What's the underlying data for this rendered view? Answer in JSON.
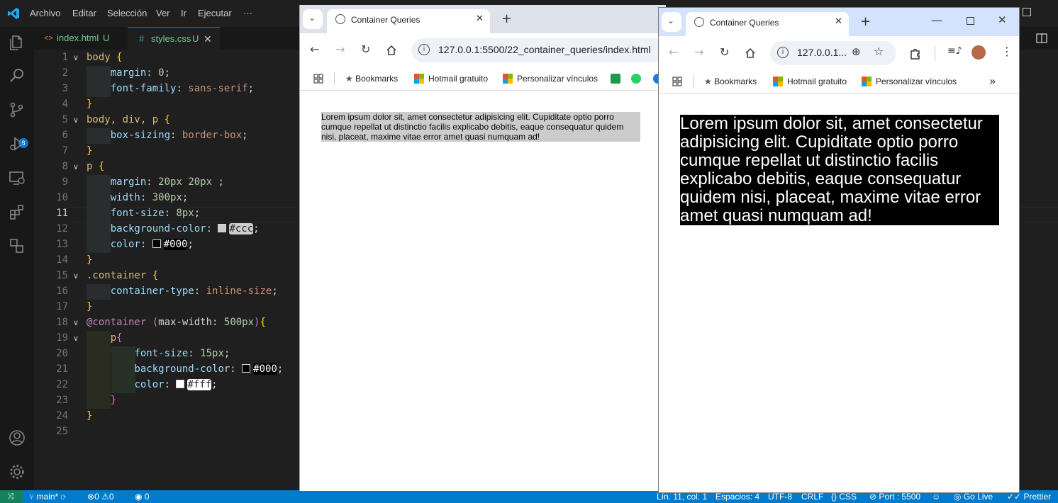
{
  "vscode": {
    "menu": [
      "Archivo",
      "Editar",
      "Selección",
      "Ver",
      "Ir",
      "Ejecutar",
      "···"
    ],
    "tabs": [
      {
        "icon": "<>",
        "name": "index.html",
        "status": "U"
      },
      {
        "icon": "#",
        "name": "styles.css",
        "status": "U"
      }
    ],
    "scm_badge": "8",
    "code_lines": [
      {
        "n": "1",
        "text": "body {"
      },
      {
        "n": "2",
        "text": "    margin: 0;"
      },
      {
        "n": "3",
        "text": "    font-family: sans-serif;"
      },
      {
        "n": "4",
        "text": "}"
      },
      {
        "n": "5",
        "text": "body, div, p {"
      },
      {
        "n": "6",
        "text": "    box-sizing: border-box;"
      },
      {
        "n": "7",
        "text": "}"
      },
      {
        "n": "8",
        "text": "p {"
      },
      {
        "n": "9",
        "text": "    margin: 20px 20px ;"
      },
      {
        "n": "10",
        "text": "    width: 300px;"
      },
      {
        "n": "11",
        "text": "    font-size: 8px;"
      },
      {
        "n": "12",
        "text": "    background-color: #ccc;"
      },
      {
        "n": "13",
        "text": "    color: #000;"
      },
      {
        "n": "14",
        "text": "}"
      },
      {
        "n": "15",
        "text": ".container {"
      },
      {
        "n": "16",
        "text": "    container-type: inline-size;"
      },
      {
        "n": "17",
        "text": "}"
      },
      {
        "n": "18",
        "text": "@container (max-width: 500px){"
      },
      {
        "n": "19",
        "text": "    p{"
      },
      {
        "n": "20",
        "text": "        font-size: 15px;"
      },
      {
        "n": "21",
        "text": "        background-color: #000;"
      },
      {
        "n": "22",
        "text": "        color: #fff;"
      },
      {
        "n": "23",
        "text": "    }"
      },
      {
        "n": "24",
        "text": "}"
      },
      {
        "n": "25",
        "text": ""
      }
    ],
    "status": {
      "branch": "main*",
      "errors": "0",
      "warnings": "0",
      "ports": "0",
      "cursor": "Lín. 11, col. 1",
      "spaces": "Espacios: 4",
      "encoding": "UTF-8",
      "eol": "CRLF",
      "language": "CSS",
      "port": "Port : 5500",
      "golive": "Go Live",
      "prettier": "Prettier"
    }
  },
  "browser1": {
    "tab_title": "Container Queries",
    "url": "127.0.0.1:5500/22_container_queries/index.html",
    "bookmarks": [
      "Bookmarks",
      "Hotmail gratuito",
      "Personalizar vínculos"
    ],
    "paragraph": "Lorem ipsum dolor sit, amet consectetur adipisicing elit. Cupiditate optio porro cumque repellat ut distinctio facilis explicabo debitis, eaque consequatur quidem nisi, placeat, maxime vitae error amet quasi numquam ad!"
  },
  "browser2": {
    "tab_title": "Container Queries",
    "url": "127.0.0.1...",
    "bookmarks": [
      "Bookmarks",
      "Hotmail gratuito",
      "Personalizar vínculos"
    ],
    "paragraph": "Lorem ipsum dolor sit, amet consectetur adipisicing elit. Cupiditate optio porro cumque repellat ut distinctio facilis explicabo debitis, eaque consequatur quidem nisi, placeat, maxime vitae error amet quasi numquam ad!"
  },
  "colors": {
    "vscode_bg": "#1f1f1f",
    "statusbar": "#007acc",
    "small_p_bg": "#cccccc",
    "big_p_bg": "#000000"
  }
}
